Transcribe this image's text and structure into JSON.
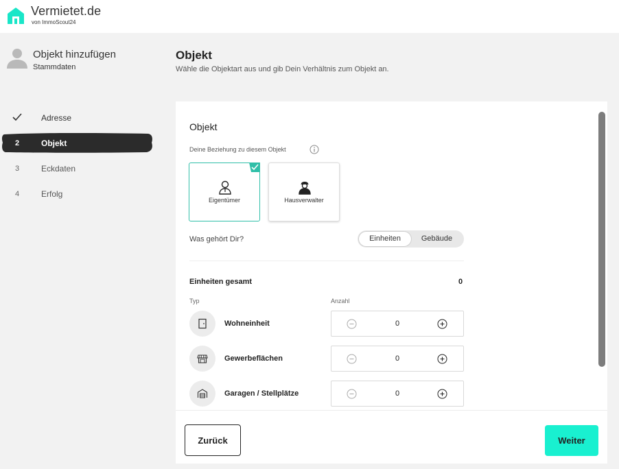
{
  "brand": {
    "name": "Vermietet.de",
    "sub": "von ImmoScout24",
    "accent": "#19f0d0",
    "teal": "#2fbfa8"
  },
  "sidebar": {
    "title": "Objekt hinzufügen",
    "subtitle": "Stammdaten",
    "steps": [
      {
        "num": "",
        "label": "Adresse",
        "state": "done"
      },
      {
        "num": "2",
        "label": "Objekt",
        "state": "active"
      },
      {
        "num": "3",
        "label": "Eckdaten",
        "state": "pending"
      },
      {
        "num": "4",
        "label": "Erfolg",
        "state": "pending"
      }
    ]
  },
  "main": {
    "title": "Objekt",
    "description": "Wähle die Objektart aus und gib Dein Verhältnis zum Objekt an."
  },
  "card": {
    "title": "Objekt",
    "relation_label": "Deine Beziehung zu diesem Objekt",
    "relations": [
      {
        "label": "Eigentümer",
        "selected": true,
        "icon": "owner-person-icon"
      },
      {
        "label": "Hausverwalter",
        "selected": false,
        "icon": "manager-person-icon"
      }
    ],
    "question": "Was gehört Dir?",
    "segments": [
      {
        "label": "Einheiten",
        "selected": true
      },
      {
        "label": "Gebäude",
        "selected": false
      }
    ],
    "total_label": "Einheiten gesamt",
    "total_value": "0",
    "col_type": "Typ",
    "col_count": "Anzahl",
    "units": [
      {
        "label": "Wohneinheit",
        "count": "0",
        "icon": "door-icon"
      },
      {
        "label": "Gewerbeflächen",
        "count": "0",
        "icon": "shop-icon"
      },
      {
        "label": "Garagen / Stellplätze",
        "count": "0",
        "icon": "garage-icon"
      }
    ]
  },
  "footer": {
    "back_label": "Zurück",
    "next_label": "Weiter"
  }
}
